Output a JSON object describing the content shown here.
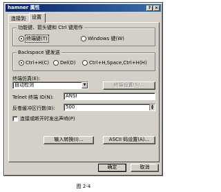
{
  "window": {
    "title": "hamner 属性",
    "help_glyph": "?",
    "close_glyph": "×"
  },
  "tabs": [
    {
      "label": "连接到"
    },
    {
      "label": "设置"
    }
  ],
  "function_keys_group": {
    "title": "功能键、箭头键和 Ctrl 键用作",
    "options": [
      {
        "label": "终端键(T)",
        "selected": true
      },
      {
        "label": "Windows 键(W)",
        "selected": false
      }
    ]
  },
  "backspace_group": {
    "title": "Backspace 键发送",
    "options": [
      {
        "label": "Ctrl+H(C)",
        "selected": true
      },
      {
        "label": "Del(D)",
        "selected": false
      },
      {
        "label": "Ctrl+H,Space,Ctrl+H(H)",
        "selected": false
      }
    ]
  },
  "emulation": {
    "label": "终端仿真(E):",
    "value": "自动检测",
    "setup_button": "终端设置(S)..."
  },
  "telnet_id": {
    "label": "Telnet 终端 ID(N):",
    "value": "ANSI"
  },
  "backscroll": {
    "label": "反卷缓冲区行数(B):",
    "value": "500"
  },
  "beep_checkbox": {
    "label": "连接或断开时发出声响(P)",
    "checked": false
  },
  "buttons": {
    "input_translation": "输入转换(I)...",
    "ascii_setup": "ASCII 码设置(A)...",
    "ok": "确定",
    "cancel": "取消"
  },
  "figure_caption": "图 2-4"
}
